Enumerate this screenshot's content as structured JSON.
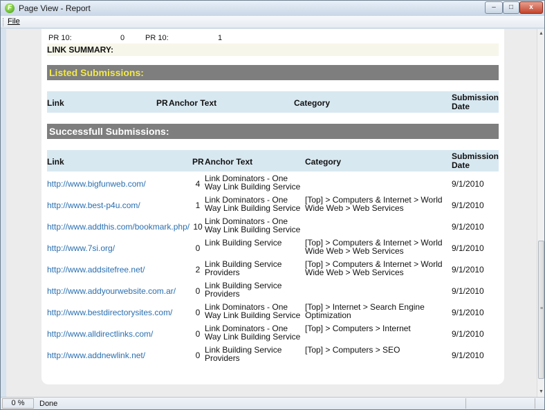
{
  "window": {
    "title": "Page View - Report",
    "app_icon": "F",
    "controls": {
      "minimize": "–",
      "maximize": "□",
      "close": "x"
    }
  },
  "menu": {
    "file_label": "File"
  },
  "report": {
    "cut_row": {
      "label_1": "PR 10:",
      "value_1": "0",
      "label_2": "PR 10:",
      "value_2": "1"
    },
    "link_summary_label": "LINK SUMMARY:",
    "listed_section": {
      "title": "Listed Submissions:",
      "headers": {
        "link": "Link",
        "pr": "PR",
        "anchor": "Anchor Text",
        "category": "Category",
        "date_line1": "Submission",
        "date_line2": "Date"
      }
    },
    "success_section": {
      "title": "Successfull Submissions:",
      "headers": {
        "link": "Link",
        "pr": "PR",
        "anchor": "Anchor Text",
        "category": "Category",
        "date_line1": "Submission",
        "date_line2": "Date"
      },
      "rows": [
        {
          "link": "http://www.bigfunweb.com/",
          "pr": "4",
          "anchor_1": "Link Dominators - One",
          "anchor_2": "Way Link Building Service",
          "cat_1": "",
          "cat_2": "",
          "date": "9/1/2010"
        },
        {
          "link": "http://www.best-p4u.com/",
          "pr": "1",
          "anchor_1": "Link Dominators - One",
          "anchor_2": "Way Link Building Service",
          "cat_1": "[Top] > Computers & Internet > World",
          "cat_2": "Wide Web > Web Services",
          "date": "9/1/2010"
        },
        {
          "link": "http://www.addthis.com/bookmark.php/",
          "pr": "10",
          "anchor_1": "Link Dominators - One",
          "anchor_2": "Way Link Building Service",
          "cat_1": "",
          "cat_2": "",
          "date": "9/1/2010"
        },
        {
          "link": "http://www.7si.org/",
          "pr": "0",
          "anchor_1": "Link Building Service",
          "anchor_2": "",
          "cat_1": "[Top] > Computers & Internet > World",
          "cat_2": "Wide Web > Web Services",
          "date": "9/1/2010"
        },
        {
          "link": "http://www.addsitefree.net/",
          "pr": "2",
          "anchor_1": "Link Building Service",
          "anchor_2": "Providers",
          "cat_1": "[Top] > Computers & Internet > World",
          "cat_2": "Wide Web > Web Services",
          "date": "9/1/2010"
        },
        {
          "link": "http://www.addyourwebsite.com.ar/",
          "pr": "0",
          "anchor_1": "Link Building Service",
          "anchor_2": "Providers",
          "cat_1": "",
          "cat_2": "",
          "date": "9/1/2010"
        },
        {
          "link": "http://www.bestdirectorysites.com/",
          "pr": "0",
          "anchor_1": "Link Dominators - One",
          "anchor_2": "Way Link Building Service",
          "cat_1": "[Top] > Internet > Search Engine",
          "cat_2": "Optimization",
          "date": "9/1/2010"
        },
        {
          "link": "http://www.alldirectlinks.com/",
          "pr": "0",
          "anchor_1": "Link Dominators - One",
          "anchor_2": "Way Link Building Service",
          "cat_1": "[Top] > Computers > Internet",
          "cat_2": "",
          "date": "9/1/2010"
        },
        {
          "link": "http://www.addnewlink.net/",
          "pr": "0",
          "anchor_1": "Link Building Service",
          "anchor_2": "Providers",
          "cat_1": "[Top] > Computers > SEO",
          "cat_2": "",
          "date": "9/1/2010"
        }
      ]
    }
  },
  "status": {
    "zoom": "0 %",
    "text": "Done"
  },
  "colors": {
    "link": "#2a6fb0",
    "section_bar": "#7e7e7e",
    "listed_title": "#f2e84a",
    "header_bg": "#d8e8f1"
  }
}
